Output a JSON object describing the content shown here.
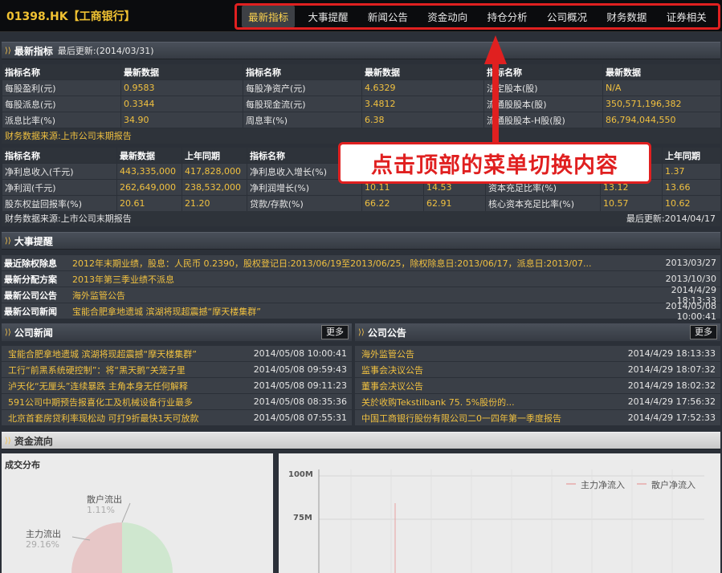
{
  "header": {
    "title": "01398.HK【工商银行】",
    "menu": [
      "最新指标",
      "大事提醒",
      "新闻公告",
      "资金动向",
      "持仓分析",
      "公司概况",
      "财务数据",
      "证券相关"
    ]
  },
  "latest": {
    "title": "最新指标",
    "updated": "最后更新:(2014/03/31)",
    "t1_head": [
      "指标名称",
      "最新数据",
      "指标名称",
      "最新数据",
      "指标名称",
      "最新数据"
    ],
    "t1_rows": [
      [
        "每股盈利(元)",
        "0.9583",
        "每股净资产(元)",
        "4.6329",
        "法定股本(股)",
        "N/A"
      ],
      [
        "每股派息(元)",
        "0.3344",
        "每股现金流(元)",
        "3.4812",
        "流通股股本(股)",
        "350,571,196,382"
      ],
      [
        "派息比率(%)",
        "34.90",
        "周息率(%)",
        "6.38",
        "流通股股本-H股(股)",
        "86,794,044,550"
      ]
    ],
    "source1": "财务数据来源:上市公司末期报告",
    "t2_head": [
      "指标名称",
      "最新数据",
      "上年同期",
      "指标名称",
      "",
      "",
      "",
      "",
      "上年同期"
    ],
    "t2_rows": [
      [
        "净利息收入(千元)",
        "443,335,000",
        "417,828,000",
        "净利息收入增长(%)",
        "",
        "",
        "",
        "",
        "1.37"
      ],
      [
        "净利润(千元)",
        "262,649,000",
        "238,532,000",
        "净利润增长(%)",
        "10.11",
        "14.53",
        "资本充足比率(%)",
        "13.12",
        "13.66"
      ],
      [
        "股东权益回报率(%)",
        "20.61",
        "21.20",
        "贷款/存款(%)",
        "66.22",
        "62.91",
        "核心资本充足比率(%)",
        "10.57",
        "10.62"
      ]
    ],
    "source2": "财务数据来源:上市公司末期报告",
    "updated2": "最后更新:2014/04/17"
  },
  "events": {
    "title": "大事提醒",
    "rows": [
      {
        "label": "最近除权除息",
        "text": "2012年末期业绩，股息：人民币 0.2390，股权登记日:2013/06/19至2013/06/25，除权除息日:2013/06/17，派息日:2013/07...",
        "date": "2013/03/27"
      },
      {
        "label": "最新分配方案",
        "text": "2013年第三季业绩不派息",
        "date": "2013/10/30"
      },
      {
        "label": "最新公司公告",
        "text": "海外监管公告",
        "date": "2014/4/29 18:13:33"
      },
      {
        "label": "最新公司新闻",
        "text": "宝能合肥拿地遗城 滨湖将现超震撼“摩天楼集群”",
        "date": "2014/05/08 10:00:41"
      }
    ]
  },
  "news": {
    "title": "公司新闻",
    "more": "更多",
    "items": [
      {
        "t": "宝能合肥拿地遗城 滨湖将现超震撼“摩天楼集群”",
        "d": "2014/05/08 10:00:41"
      },
      {
        "t": "工行“前黑系统硬控制”：将“黑天鹅”关笼子里",
        "d": "2014/05/08 09:59:43"
      },
      {
        "t": "泸天化“无厘头”连续暴跌 主角本身无任何解释",
        "d": "2014/05/08 09:11:23"
      },
      {
        "t": "591公司中期预告报喜化工及机械设备行业最多",
        "d": "2014/05/08 08:35:36"
      },
      {
        "t": "北京首套房贷利率现松动 可打9折最快1天可放款",
        "d": "2014/05/08 07:55:31"
      }
    ]
  },
  "notices": {
    "title": "公司公告",
    "more": "更多",
    "items": [
      {
        "t": "海外监管公告",
        "d": "2014/4/29 18:13:33"
      },
      {
        "t": "监事会决议公告",
        "d": "2014/4/29 18:07:32"
      },
      {
        "t": "董事会决议公告",
        "d": "2014/4/29 18:02:32"
      },
      {
        "t": "关於收购Tekstilbank 75. 5%股份的...",
        "d": "2014/4/29 17:56:32"
      },
      {
        "t": "中国工商银行股份有限公司二0一四年第一季度报告",
        "d": "2014/4/29 17:52:33"
      }
    ]
  },
  "funds": {
    "title": "资金流向",
    "left_title": "成交分布",
    "retail_label": "散户流出",
    "retail_pct": "1.11%",
    "main_label": "主力流出",
    "main_pct": "29.16%",
    "y_ticks": [
      "100M",
      "75M"
    ],
    "legend": [
      "主力净流入",
      "散户净流入"
    ]
  },
  "callout": "点击顶部的菜单切换内容",
  "colors": {
    "accent": "#f0c040",
    "highlight": "#e02020"
  }
}
